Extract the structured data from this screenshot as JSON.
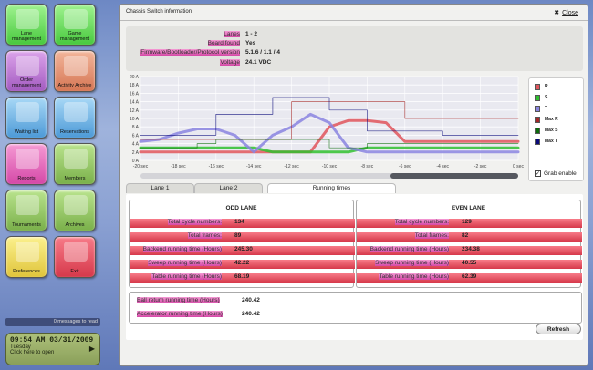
{
  "menu": {
    "tiles": [
      {
        "label": "Lane management",
        "color": "#7ddb6e"
      },
      {
        "label": "Game management",
        "color": "#7ddb6e"
      },
      {
        "label": "Order management",
        "color": "#c07fd6"
      },
      {
        "label": "Activity Archive",
        "color": "#e89676"
      },
      {
        "label": "Waiting list",
        "color": "#7ab8ea"
      },
      {
        "label": "Reservations",
        "color": "#7ab8ea"
      },
      {
        "label": "Reports",
        "color": "#e76fbf"
      },
      {
        "label": "Members",
        "color": "#99c86a"
      },
      {
        "label": "Tournaments",
        "color": "#99c86a"
      },
      {
        "label": "Archives",
        "color": "#99c86a"
      },
      {
        "label": "Preferences",
        "color": "#f1de62"
      },
      {
        "label": "Exit",
        "color": "#ea5767"
      }
    ]
  },
  "messages": "0 messages to read",
  "clock": {
    "time": "09:54 AM 03/31/2009",
    "day": "Tuesday",
    "hint": "Click here to open"
  },
  "window": {
    "title": "Chassis Switch information",
    "close_label": "Close"
  },
  "info": {
    "rows": [
      {
        "key": "Lanes",
        "value": "1 - 2"
      },
      {
        "key": "Board found",
        "value": "Yes"
      },
      {
        "key": "Firmware/Bootloader/Protocol version",
        "value": "5.1.6 / 1.1 / 4"
      },
      {
        "key": "Voltage",
        "value": "24.1 VDC"
      }
    ]
  },
  "chart_data": {
    "type": "line",
    "x": [
      -20,
      -19,
      -18,
      -17,
      -16,
      -15,
      -14,
      -13,
      -12,
      -11,
      -10,
      -9,
      -8,
      -7,
      -6,
      -5,
      -4,
      -3,
      -2,
      -1,
      0
    ],
    "x_ticks": [
      "-20 sec",
      "-18 sec",
      "-16 sec",
      "-14 sec",
      "-12 sec",
      "-10 sec",
      "-8 sec",
      "-6 sec",
      "-4 sec",
      "-2 sec",
      "0 sec"
    ],
    "y_ticks": [
      "0 A",
      "2 A",
      "4 A",
      "6 A",
      "8 A",
      "10 A",
      "12 A",
      "14 A",
      "16 A",
      "18 A",
      "20 A"
    ],
    "ylim": [
      0,
      20
    ],
    "xlim": [
      -20,
      0
    ],
    "series": [
      {
        "name": "R",
        "color": "#e0555c",
        "values": [
          2,
          2,
          2,
          2,
          2,
          2,
          2,
          2,
          2,
          2,
          8,
          9.5,
          9.5,
          9,
          4.5,
          4.5,
          4.5,
          4.5,
          4.5,
          4.5,
          4.5
        ]
      },
      {
        "name": "S",
        "color": "#2fbf2f",
        "values": [
          3,
          3,
          3,
          3,
          3,
          3,
          3,
          2,
          2,
          2,
          2,
          2,
          3,
          3,
          3,
          3,
          3,
          3,
          3,
          3,
          3
        ]
      },
      {
        "name": "T",
        "color": "#8a84e0",
        "values": [
          4.5,
          5,
          6.5,
          7.5,
          7.5,
          6,
          2,
          6,
          8,
          11,
          9,
          3,
          2,
          2,
          2,
          2,
          2,
          2,
          2,
          2,
          2
        ]
      },
      {
        "name": "Max R",
        "color": "#a32727",
        "values": [
          5,
          5,
          5,
          5,
          5,
          5,
          5,
          5,
          14,
          14,
          14,
          14,
          14,
          14,
          10,
          10,
          10,
          10,
          10,
          10,
          10
        ]
      },
      {
        "name": "Max S",
        "color": "#0b6b0b",
        "values": [
          3,
          3,
          3,
          4,
          5,
          5,
          5,
          5,
          5,
          5,
          3,
          3,
          4,
          4,
          4,
          4,
          4,
          4,
          4,
          4,
          4
        ]
      },
      {
        "name": "Max T",
        "color": "#0a0a7a",
        "values": [
          6,
          6,
          6,
          6,
          11,
          11,
          11,
          15,
          15,
          15,
          12,
          12,
          7,
          7,
          7,
          7,
          6,
          6,
          6,
          6,
          6
        ]
      }
    ],
    "grid": true,
    "legend": "right"
  },
  "grab_label": "Grab enable",
  "tabs": [
    "Lane 1",
    "Lane 2",
    "Running times"
  ],
  "odd": {
    "title": "ODD LANE",
    "rows": [
      {
        "key": "Total cycle numbers:",
        "value": "134"
      },
      {
        "key": "Total frames:",
        "value": "89"
      },
      {
        "key": "Backend running time (Hours)",
        "value": "245.30"
      },
      {
        "key": "Sweep running time (Hours)",
        "value": "42.22"
      },
      {
        "key": "Table running time (Hours)",
        "value": "68.19"
      }
    ]
  },
  "even": {
    "title": "EVEN LANE",
    "rows": [
      {
        "key": "Total cycle numbers:",
        "value": "129"
      },
      {
        "key": "Total frames:",
        "value": "82"
      },
      {
        "key": "Backend running time (Hours)",
        "value": "234.38"
      },
      {
        "key": "Sweep running time (Hours)",
        "value": "40.55"
      },
      {
        "key": "Table running time (Hours)",
        "value": "62.39"
      }
    ]
  },
  "extra": {
    "rows": [
      {
        "key": "Ball return running time (Hours)",
        "value": "240.42"
      },
      {
        "key": "Accelerator running time (Hours)",
        "value": "240.42"
      }
    ]
  },
  "refresh_label": "Refresh"
}
